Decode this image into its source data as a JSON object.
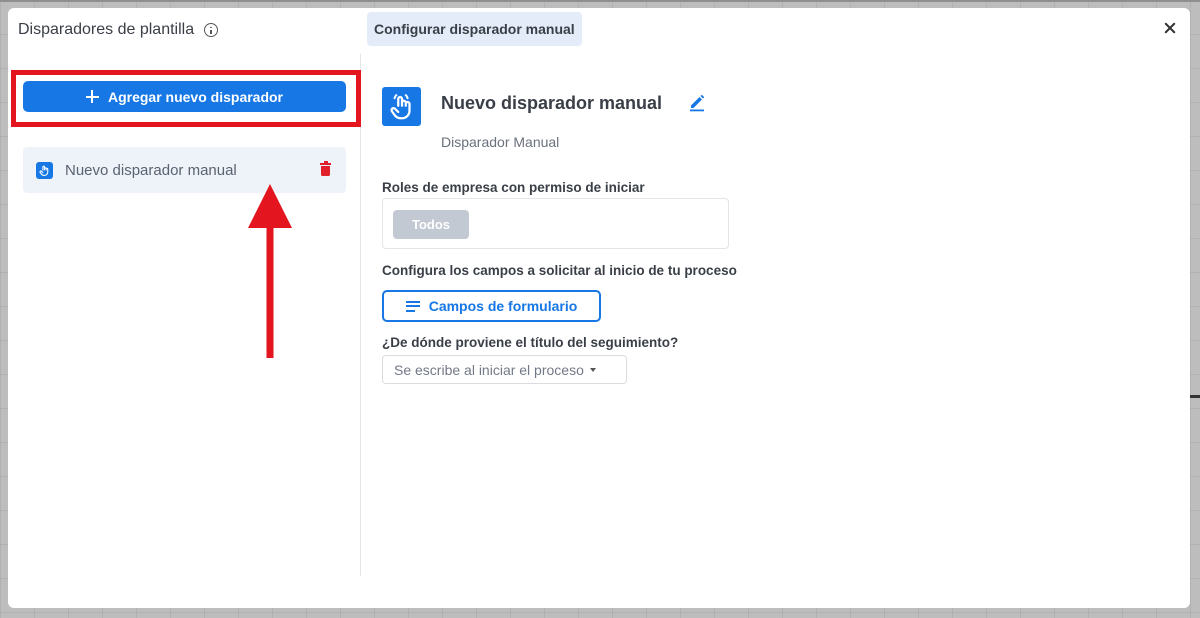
{
  "modal": {
    "title": "Disparadores de plantilla",
    "tab_label": "Configurar disparador manual"
  },
  "sidebar": {
    "add_button_label": "Agregar nuevo disparador",
    "items": [
      {
        "label": "Nuevo disparador manual"
      }
    ]
  },
  "trigger": {
    "title": "Nuevo disparador manual",
    "subtitle": "Disparador Manual"
  },
  "form": {
    "roles_label": "Roles de empresa con permiso de iniciar",
    "roles_chip": "Todos",
    "fields_label": "Configura los campos a solicitar al inicio de tu proceso",
    "fields_button": "Campos de formulario",
    "title_source_label": "¿De dónde proviene el título del seguimiento?",
    "title_source_value": "Se escribe al iniciar el proceso"
  },
  "colors": {
    "primary": "#1677e5",
    "highlight": "#e3161f",
    "danger": "#e0202a"
  },
  "icons": [
    "info-icon",
    "close-icon",
    "plus-icon",
    "hand-tap-icon",
    "trash-icon",
    "pencil-icon",
    "lines-icon",
    "caret-down-icon"
  ]
}
